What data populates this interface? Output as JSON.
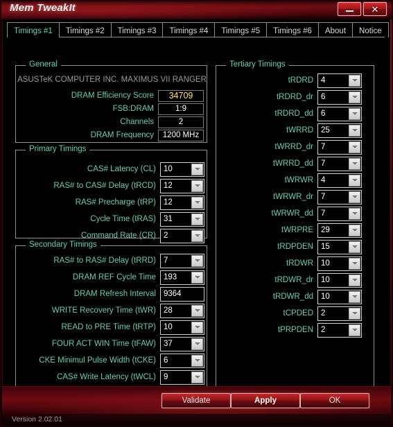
{
  "window": {
    "title": "Mem TweakIt",
    "minimize_label": "minimize",
    "close_label": "close",
    "version": "Version 2.02.01"
  },
  "tabs": [
    {
      "label": "Timings #1",
      "active": true
    },
    {
      "label": "Timings #2",
      "active": false
    },
    {
      "label": "Timings #3",
      "active": false
    },
    {
      "label": "Timings #4",
      "active": false
    },
    {
      "label": "Timings #5",
      "active": false
    },
    {
      "label": "Timings #6",
      "active": false
    },
    {
      "label": "About",
      "active": false
    },
    {
      "label": "Notice",
      "active": false
    }
  ],
  "general": {
    "legend": "General",
    "motherboard": "ASUSTeK COMPUTER INC. MAXIMUS VII RANGER",
    "rows": [
      {
        "label": "DRAM Efficiency Score",
        "value": "34709",
        "highlight": true
      },
      {
        "label": "FSB:DRAM",
        "value": "1:9",
        "highlight": false
      },
      {
        "label": "Channels",
        "value": "2",
        "highlight": false
      },
      {
        "label": "DRAM Frequency",
        "value": "1200 MHz",
        "highlight": false
      }
    ]
  },
  "primary": {
    "legend": "Primary Timings",
    "rows": [
      {
        "label": "CAS# Latency (CL)",
        "value": "10"
      },
      {
        "label": "RAS# to CAS# Delay (tRCD)",
        "value": "12"
      },
      {
        "label": "RAS# Precharge (tRP)",
        "value": "12"
      },
      {
        "label": "Cycle Time (tRAS)",
        "value": "31"
      },
      {
        "label": "Command Rate (CR)",
        "value": "2"
      }
    ]
  },
  "secondary": {
    "legend": "Secondary Timings",
    "rows": [
      {
        "label": "RAS# to RAS# Delay (tRRD)",
        "value": "7",
        "combo": true
      },
      {
        "label": "DRAM REF Cycle Time",
        "value": "193",
        "combo": true
      },
      {
        "label": "DRAM Refresh Interval",
        "value": "9364",
        "combo": false
      },
      {
        "label": "WRITE Recovery Time (tWR)",
        "value": "28",
        "combo": true
      },
      {
        "label": "READ to PRE Time (tRTP)",
        "value": "10",
        "combo": true
      },
      {
        "label": "FOUR ACT WIN Time (tFAW)",
        "value": "37",
        "combo": true
      },
      {
        "label": "CKE Minimul Pulse Width (tCKE)",
        "value": "6",
        "combo": true
      },
      {
        "label": "CAS# Write Latency (tWCL)",
        "value": "9",
        "combo": true
      }
    ]
  },
  "tertiary": {
    "legend": "Tertiary Timings",
    "rows": [
      {
        "label": "tRDRD",
        "value": "4"
      },
      {
        "label": "tRDRD_dr",
        "value": "6"
      },
      {
        "label": "tRDRD_dd",
        "value": "6"
      },
      {
        "label": "tWRRD",
        "value": "25"
      },
      {
        "label": "tWRRD_dr",
        "value": "7"
      },
      {
        "label": "tWRRD_dd",
        "value": "7"
      },
      {
        "label": "tWRWR",
        "value": "4"
      },
      {
        "label": "tWRWR_dr",
        "value": "7"
      },
      {
        "label": "tWRWR_dd",
        "value": "7"
      },
      {
        "label": "tWRPRE",
        "value": "29"
      },
      {
        "label": "tRDPDEN",
        "value": "15"
      },
      {
        "label": "tRDWR",
        "value": "10"
      },
      {
        "label": "tRDWR_dr",
        "value": "10"
      },
      {
        "label": "tRDWR_dd",
        "value": "10"
      },
      {
        "label": "tCPDED",
        "value": "2"
      },
      {
        "label": "tPRPDEN",
        "value": "2"
      }
    ]
  },
  "buttons": {
    "validate": "Validate",
    "apply": "Apply",
    "ok": "OK"
  },
  "colors": {
    "accent_red": "#8f1418",
    "label_teal": "#67cdb3",
    "score_yellow": "#ffe45e"
  }
}
